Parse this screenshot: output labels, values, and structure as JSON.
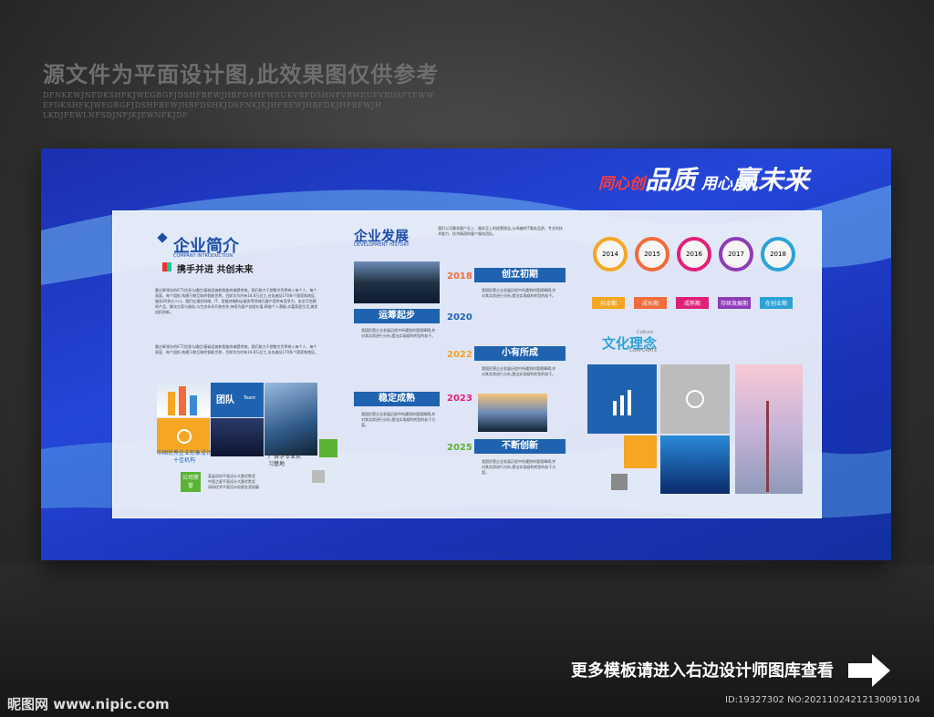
{
  "disclaimer": "源文件为平面设计图,此效果图仅供参考",
  "noise_lines": [
    "DFNKEWJNFDKSHFKJWEGBGFJDSHFBEWJHBFDSHFWEUKVBFDSHNFVBWEUFVBDSFYEWW",
    "EFDKSHFKJWEGBGFJDSHFBEWJHBFDSHKJDSFNKJKJHFBEWJHBFDKJHFBEWJH",
    "LKDJFEWLNFSDJNFJKJEWNFKJDF"
  ],
  "slogan": {
    "a": "同心创",
    "b": "品质",
    "c": " 用心",
    "d": "赢未来"
  },
  "intro": {
    "title": "企业简介",
    "subtitle": "COMPANY INTRODUCTION",
    "tagline": "携手并进 共创未来",
    "para1": "晨企辉领先的ICT(信息与通信)基础设施和智能终端提供商。我们致力于把数字世界带入每个人、每个家庭、每个组织,构建万物互联的智能世界。目前华为约有18.8万员工,业务遍及170多个国家和地区,服务30多亿人口。我们在通信网络、IT、智能终端和云服务等领域为客户提供有竞争力、安全可信赖的产品、解决方案与服务,与生态伙伴开放合作,持续为客户创造价值,释放个人潜能,丰富家庭生活,激发组织创新。",
    "para2": "晨企辉领先的ICT(信息与通信)基础设施和智能终端提供商。我们致力于把数字世界带入每个人、每个家庭、每个组织,构建万物互联的智能世界。目前华为约有18.8万员工,业务遍及170多个国家和地区。",
    "team_label": "团队",
    "team_en": "Team",
    "award1": "中国优秀企业形象设计十佳机构",
    "award2": "广告学专业实习基地",
    "honor": "公司荣誉",
    "honor_lines": [
      "某届深圳平面设计大赛优胜奖",
      "中国之星平面设计大赛优胜奖",
      "深圳优秀平面设计创意金奖前篇"
    ]
  },
  "history": {
    "title": "企业发展",
    "subtitle": "DEVELOPMENT HISTORY",
    "desc": "我们公司秉承客户至上、服务至上的经营理念,以卓越的IT服务品质、专业的技术能力、技术精湛的客户服务团队。",
    "stages": [
      {
        "year": "2018",
        "label": "创立初期"
      },
      {
        "year": "2020",
        "label": "运筹起步"
      },
      {
        "year": "2022",
        "label": "小有所成"
      },
      {
        "year": "2023",
        "label": "稳定成熟"
      },
      {
        "year": "2025",
        "label": "不断创新"
      }
    ],
    "body": "我国民营企业发展历程中所遇到的管理障碍,并对其实质进行分析,提出实现顺利转型的若干。",
    "body_short": "我国民营企业发展历程中所遇到的管理障碍,并对其实质进行分析,提出实现顺利转型的若干方案。"
  },
  "culture": {
    "timeline": [
      {
        "year": "2014",
        "label": "创业期",
        "color": "#f5a623"
      },
      {
        "year": "2015",
        "label": "成长期",
        "color": "#f26b3a"
      },
      {
        "year": "2016",
        "label": "成熟期",
        "color": "#e0207a"
      },
      {
        "year": "2017",
        "label": "持续发展期",
        "color": "#8e3bb8"
      },
      {
        "year": "2018",
        "label": "在创业期",
        "color": "#2aa3d8"
      }
    ],
    "title": "文化理念",
    "title_en1": "Culture",
    "title_en2": "CORPORATE"
  },
  "footer": {
    "more": "更多模板请进入右边设计师图库查看",
    "logo": "昵图网 www.nipic.com",
    "id": "ID:19327302 NO:20211024212130091104"
  }
}
